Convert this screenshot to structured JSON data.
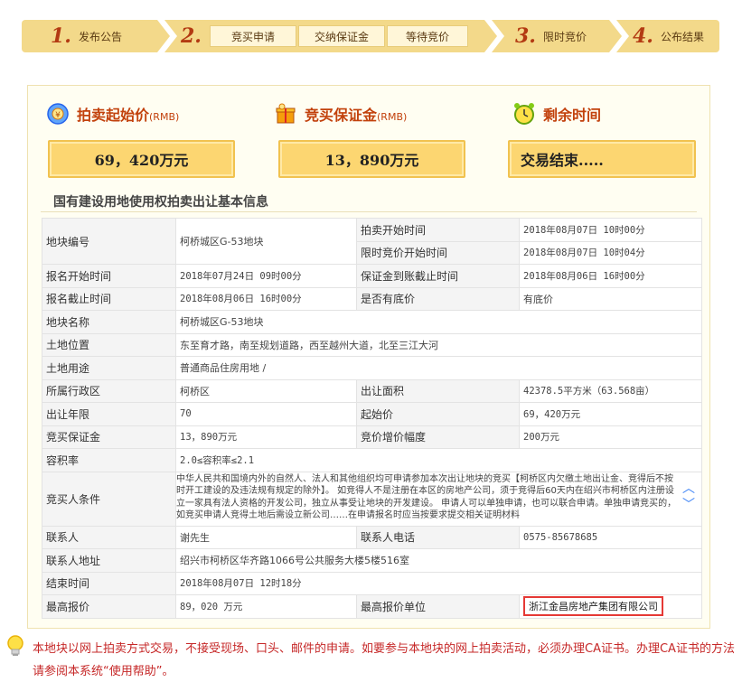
{
  "steps": {
    "step1": {
      "num": "1.",
      "label": "发布公告"
    },
    "step2": {
      "num": "2.",
      "sub": [
        "竞买申请",
        "交纳保证金",
        "等待竞价"
      ]
    },
    "step3": {
      "num": "3.",
      "label": "限时竞价"
    },
    "step4": {
      "num": "4.",
      "label": "公布结果"
    }
  },
  "summary": {
    "start_price": {
      "label": "拍卖起始价",
      "unit": "(RMB)",
      "value": "69，420万元"
    },
    "deposit": {
      "label": "竞买保证金",
      "unit": "(RMB)",
      "value": "13，890万元"
    },
    "remaining": {
      "label": "剩余时间",
      "value": "交易结束....."
    }
  },
  "section_title": "国有建设用地使用权拍卖出让基本信息",
  "table": {
    "plot_no": {
      "k": "地块编号",
      "v": "柯桥城区G-53地块"
    },
    "auction_start": {
      "k": "拍卖开始时间",
      "v": "2018年08月07日 10时00分"
    },
    "timed_bid_start": {
      "k": "限时竞价开始时间",
      "v": "2018年08月07日 10时04分"
    },
    "reg_start": {
      "k": "报名开始时间",
      "v": "2018年07月24日 09时00分"
    },
    "deposit_deadline": {
      "k": "保证金到账截止时间",
      "v": "2018年08月06日 16时00分"
    },
    "reg_end": {
      "k": "报名截止时间",
      "v": "2018年08月06日 16时00分"
    },
    "reserve": {
      "k": "是否有底价",
      "v": "有底价"
    },
    "plot_name": {
      "k": "地块名称",
      "v": "柯桥城区G-53地块"
    },
    "location": {
      "k": "土地位置",
      "v": "东至育才路，南至规划道路，西至越州大道，北至三江大河"
    },
    "usage": {
      "k": "土地用途",
      "v": "普通商品住房用地 /"
    },
    "district": {
      "k": "所属行政区",
      "v": "柯桥区"
    },
    "area": {
      "k": "出让面积",
      "v": "42378.5平方米（63.568亩）"
    },
    "term": {
      "k": "出让年限",
      "v": "70"
    },
    "start_price": {
      "k": "起始价",
      "v": "69，420万元"
    },
    "deposit": {
      "k": "竞买保证金",
      "v": "13，890万元"
    },
    "increment": {
      "k": "竞价增价幅度",
      "v": "200万元"
    },
    "far": {
      "k": "容积率",
      "v": "2.0≤容积率≤2.1"
    },
    "conditions": {
      "k": "竞买人条件",
      "v": "中华人民共和国境内外的自然人、法人和其他组织均可申请参加本次出让地块的竞买【柯桥区内欠缴土地出让金、竞得后不按时开工建设的及违法规有规定的除外】。 如竞得人不是注册在本区的房地产公司，须于竞得后60天内在绍兴市柯桥区内注册设立一家具有法人资格的开发公司，独立从事受让地块的开发建设。 申请人可以单独申请，也可以联合申请。单独申请竞买的，如竞买申请人竞得土地后需设立新公司……在申请报名时应当按要求提交相关证明材料"
    },
    "contact": {
      "k": "联系人",
      "v": "谢先生"
    },
    "phone": {
      "k": "联系人电话",
      "v": "0575-85678685"
    },
    "address": {
      "k": "联系人地址",
      "v": "绍兴市柯桥区华齐路1066号公共服务大楼5楼516室"
    },
    "end_time": {
      "k": "结束时间",
      "v": "2018年08月07日 12时18分"
    },
    "highest_bid": {
      "k": "最高报价",
      "v": "89，020 万元"
    },
    "winner": {
      "k": "最高报价单位",
      "v": "浙江金昌房地产集团有限公司"
    }
  },
  "notice": "本地块以网上拍卖方式交易，不接受现场、口头、邮件的申请。如要参与本地块的网上拍卖活动，必须办理CA证书。办理CA证书的方法请参阅本系统“使用帮助”。",
  "icons": [
    "coins-icon",
    "gift-icon",
    "alarm-clock-icon",
    "lightbulb-icon"
  ],
  "colors": {
    "accent": "#c2410c",
    "step_bar": "#f3d98a",
    "value_box": "#fcd671",
    "notice": "#c62828",
    "highlight": "#e53935"
  }
}
